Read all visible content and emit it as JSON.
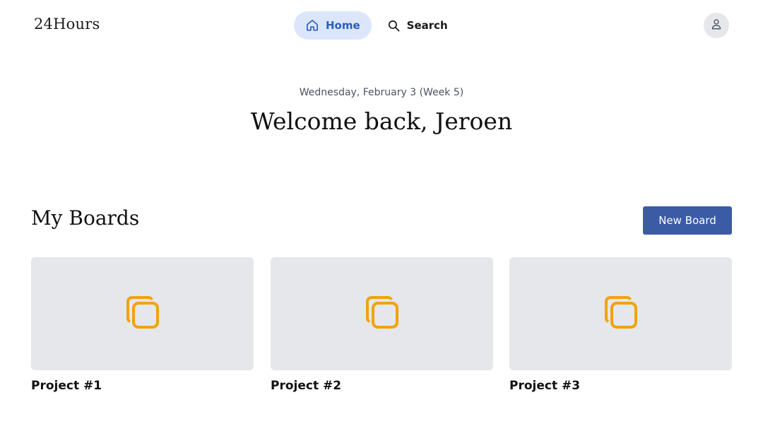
{
  "app": {
    "logo": "24Hours"
  },
  "nav": {
    "items": [
      {
        "label": "Home",
        "icon": "home-icon",
        "active": true
      },
      {
        "label": "Search",
        "icon": "search-icon",
        "active": false
      }
    ],
    "profile_icon": "user-icon"
  },
  "hero": {
    "date": "Wednesday, February 3 (Week 5)",
    "greeting": "Welcome back, Jeroen"
  },
  "boards": {
    "title": "My Boards",
    "new_button_label": "New Board",
    "items": [
      {
        "label": "Project #1",
        "icon": "board-copy-icon"
      },
      {
        "label": "Project #2",
        "icon": "board-copy-icon"
      },
      {
        "label": "Project #3",
        "icon": "board-copy-icon"
      }
    ]
  },
  "colors": {
    "accent": "#3b5ba5",
    "nav_active_bg": "#dbe6fb",
    "nav_active_text": "#2d5dba",
    "card_bg": "#e5e7eb",
    "board_icon": "#f2a20f"
  }
}
